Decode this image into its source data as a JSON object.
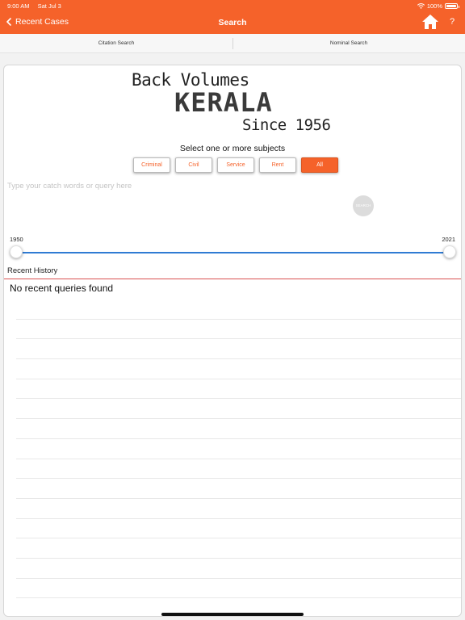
{
  "status_bar": {
    "time": "9:00 AM",
    "date": "Sat Jul 3",
    "battery": "100%"
  },
  "nav": {
    "back_label": "Recent Cases",
    "title": "Search",
    "help_label": "?"
  },
  "segments": [
    {
      "label": "Citation Search"
    },
    {
      "label": "Nominal Search"
    }
  ],
  "logo": {
    "line1": "Back Volumes",
    "line2": "KERALA",
    "line3": "Since 1956"
  },
  "subjects": {
    "prompt": "Select one or more subjects",
    "items": [
      {
        "label": "Criminal",
        "selected": false
      },
      {
        "label": "Civil",
        "selected": false
      },
      {
        "label": "Service",
        "selected": false
      },
      {
        "label": "Rent",
        "selected": false
      },
      {
        "label": "All",
        "selected": true
      }
    ]
  },
  "query": {
    "placeholder": "Type your catch words or query here",
    "value": ""
  },
  "search_button": {
    "label": "SEARCH"
  },
  "year_range": {
    "min_label": "1950",
    "max_label": "2021",
    "low": 1950,
    "high": 2021
  },
  "recent": {
    "label": "Recent History",
    "empty_message": "No recent queries found"
  },
  "colors": {
    "accent": "#f5622a",
    "slider": "#2f7bd3",
    "divider_red": "#d95050"
  }
}
